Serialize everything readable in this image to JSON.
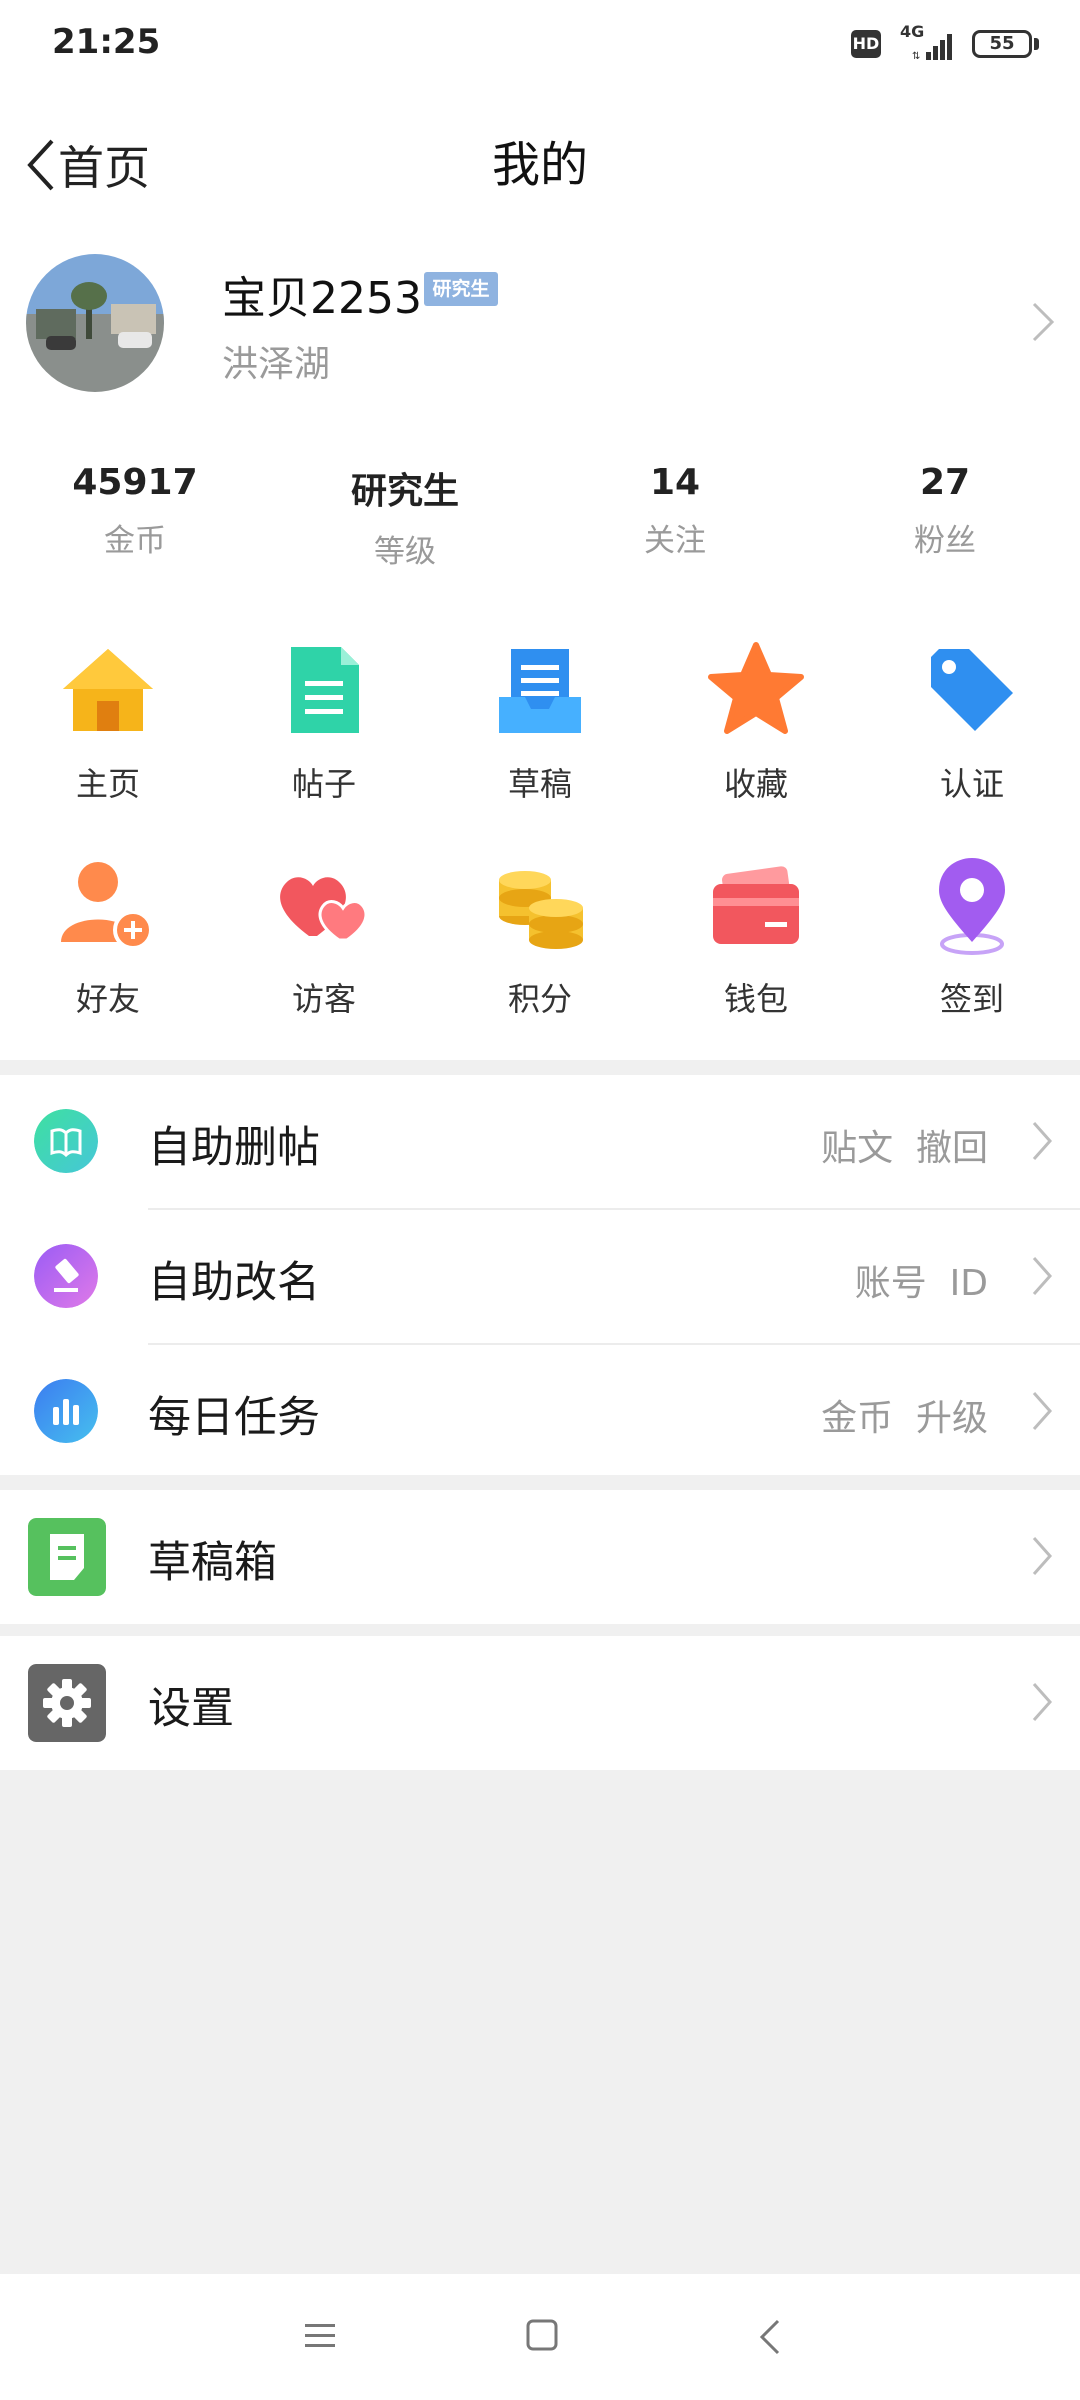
{
  "status_bar": {
    "time": "21:25",
    "hd": "HD",
    "network": "4G",
    "battery": "55"
  },
  "nav": {
    "back_label": "首页",
    "title": "我的"
  },
  "profile": {
    "username": "宝贝2253",
    "level_badge": "研究生",
    "location": "洪泽湖"
  },
  "stats": [
    {
      "value": "45917",
      "label": "金币"
    },
    {
      "value": "研究生",
      "label": "等级"
    },
    {
      "value": "14",
      "label": "关注"
    },
    {
      "value": "27",
      "label": "粉丝"
    }
  ],
  "grid": [
    {
      "label": "主页",
      "icon": "home-icon",
      "color": "#f6b41a"
    },
    {
      "label": "帖子",
      "icon": "document-icon",
      "color": "#2fd3a8"
    },
    {
      "label": "草稿",
      "icon": "draft-tray-icon",
      "color": "#2f8ff0"
    },
    {
      "label": "收藏",
      "icon": "star-icon",
      "color": "#ff7a33"
    },
    {
      "label": "认证",
      "icon": "tag-icon",
      "color": "#2f8ff0"
    },
    {
      "label": "好友",
      "icon": "add-friend-icon",
      "color": "#ff8a4c"
    },
    {
      "label": "访客",
      "icon": "visitor-hearts-icon",
      "color": "#f2575e"
    },
    {
      "label": "积分",
      "icon": "coins-icon",
      "color": "#f5c12e"
    },
    {
      "label": "钱包",
      "icon": "wallet-card-icon",
      "color": "#f2575e"
    },
    {
      "label": "签到",
      "icon": "location-pin-icon",
      "color": "#a25cf0"
    }
  ],
  "list": [
    {
      "title": "自助删帖",
      "right": "贴文  撤回",
      "icon": "book-icon",
      "color": "#3fd7a6"
    },
    {
      "title": "自助改名",
      "right": "账号  ID",
      "icon": "eraser-icon",
      "color": "#b56cf0"
    },
    {
      "title": "每日任务",
      "right": "金币  升级",
      "icon": "bar-chart-icon",
      "color": "#3f9ef5"
    }
  ],
  "draft_box": {
    "title": "草稿箱",
    "icon": "draft-box-icon",
    "color": "#56c15e"
  },
  "settings": {
    "title": "设置",
    "icon": "gear-icon",
    "color": "#666666"
  },
  "system_nav": {
    "menu": "menu-icon",
    "home": "home-square-icon",
    "back": "back-arrow-icon"
  }
}
